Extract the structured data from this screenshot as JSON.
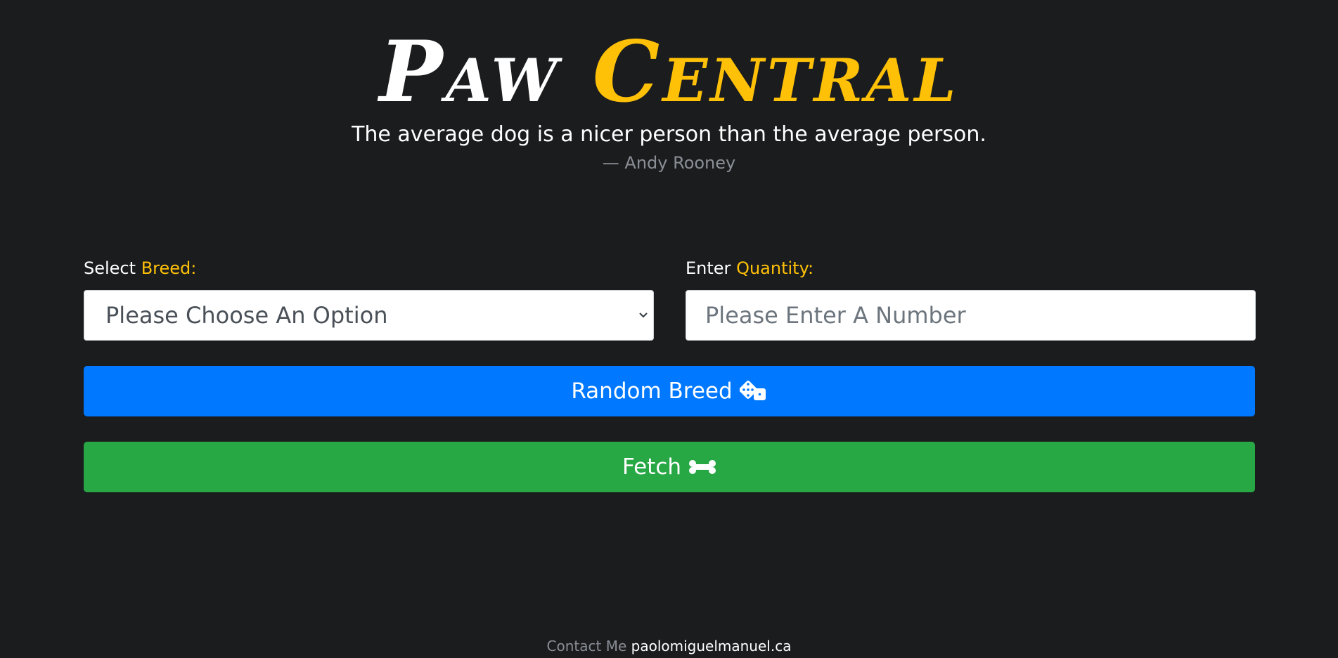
{
  "header": {
    "title_part1": "Paw",
    "title_part2": "Central",
    "quote": "The average dog is a nicer person than the average person.",
    "author": "— Andy Rooney"
  },
  "form": {
    "breed_label": "Select",
    "breed_label_accent": "Breed:",
    "breed_select_value": "Please Choose An Option",
    "quantity_label": "Enter",
    "quantity_label_accent": "Quantity:",
    "quantity_placeholder": "Please Enter A Number"
  },
  "buttons": {
    "random_label": "Random Breed",
    "random_icon": "dice-icon",
    "fetch_label": "Fetch",
    "fetch_icon": "bone-icon"
  },
  "footer": {
    "contact_text": "Contact Me",
    "contact_link": "paolomiguelmanuel.ca"
  },
  "colors": {
    "background": "#1b1c1e",
    "accent": "#ffc107",
    "primary": "#0078ff",
    "success": "#28a745"
  }
}
